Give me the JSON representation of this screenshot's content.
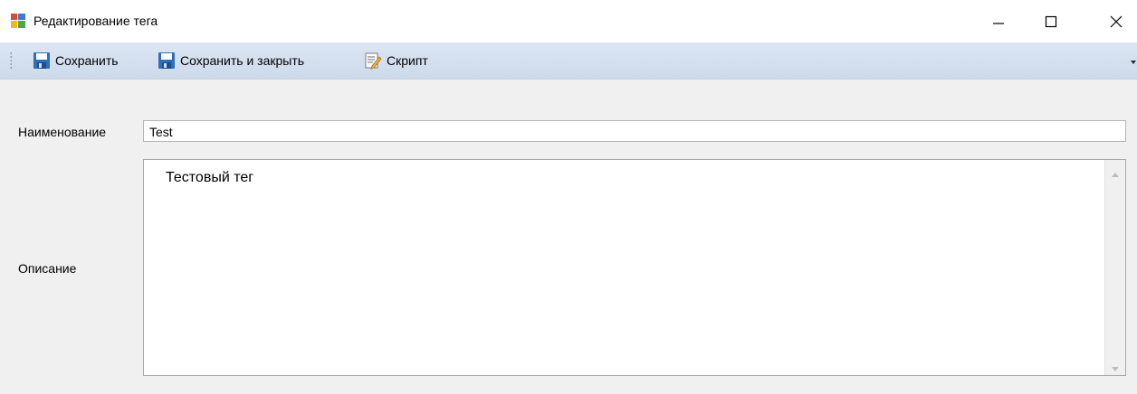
{
  "window": {
    "title": "Редактирование тега",
    "icon": "form-window-icon"
  },
  "toolbar": {
    "buttons": [
      {
        "label": "Сохранить",
        "icon": "floppy-disk-icon"
      },
      {
        "label": "Сохранить и закрыть",
        "icon": "floppy-disk-icon"
      },
      {
        "label": "Скрипт",
        "icon": "script-edit-icon"
      }
    ]
  },
  "form": {
    "name_label": "Наименование",
    "name_value": "Test",
    "description_label": "Описание",
    "description_value": "Тестовый тег"
  },
  "colors": {
    "toolbar_bg": "#dce6f4",
    "form_bg": "#f0f0f0",
    "floppy_blue": "#2f6fb8"
  }
}
